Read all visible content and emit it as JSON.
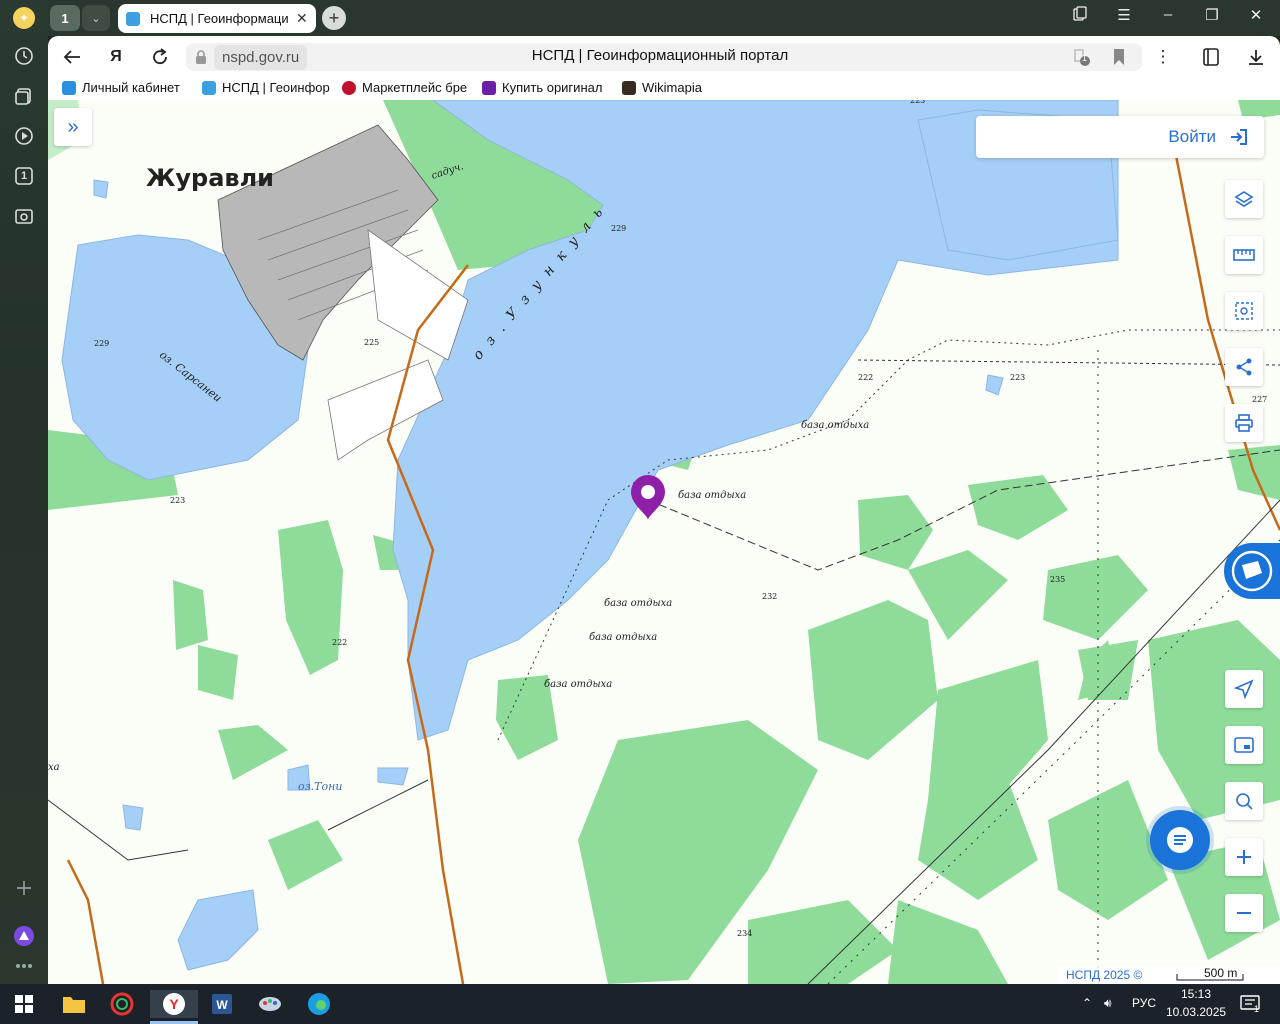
{
  "browser": {
    "tab_count": "1",
    "tab_title": "НСПД | Геоинформаци",
    "domain": "nspd.gov.ru",
    "page_title": "НСПД | Геоинформационный портал",
    "ext_badge": "1",
    "sidebar_badge": "1"
  },
  "bookmarks": [
    {
      "label": "Личный кабинет"
    },
    {
      "label": "НСПД | Геоинфор"
    },
    {
      "label": "Маркетплейс бре"
    },
    {
      "label": "Купить оригинал"
    },
    {
      "label": "Wikimapia"
    }
  ],
  "map": {
    "login_label": "Войти",
    "labels": {
      "village": "Журавли",
      "lake1": "оз. Сарсанеи",
      "lake2": "о з . У з у н к у л ь",
      "lake3": "оз.Тони",
      "garden": "садуч.",
      "base1": "база отдыха",
      "base2": "база отдыха",
      "base3": "база отдыха",
      "base4": "база отдыха",
      "base5": "база отдыха",
      "partial": "ха"
    },
    "elevations": [
      "223",
      "229",
      "225",
      "222",
      "223",
      "223",
      "222",
      "232",
      "235",
      "227",
      "234",
      "229"
    ],
    "copyright": "НСПД 2025 ©",
    "scale": "500 m"
  },
  "taskbar": {
    "lang": "РУС",
    "time": "15:13",
    "date": "10.03.2025",
    "notif": "1"
  },
  "colors": {
    "water": "#a6cff7",
    "forest": "#8fdc9a",
    "accent": "#2a6fd0",
    "pin": "#8e1fa8"
  }
}
